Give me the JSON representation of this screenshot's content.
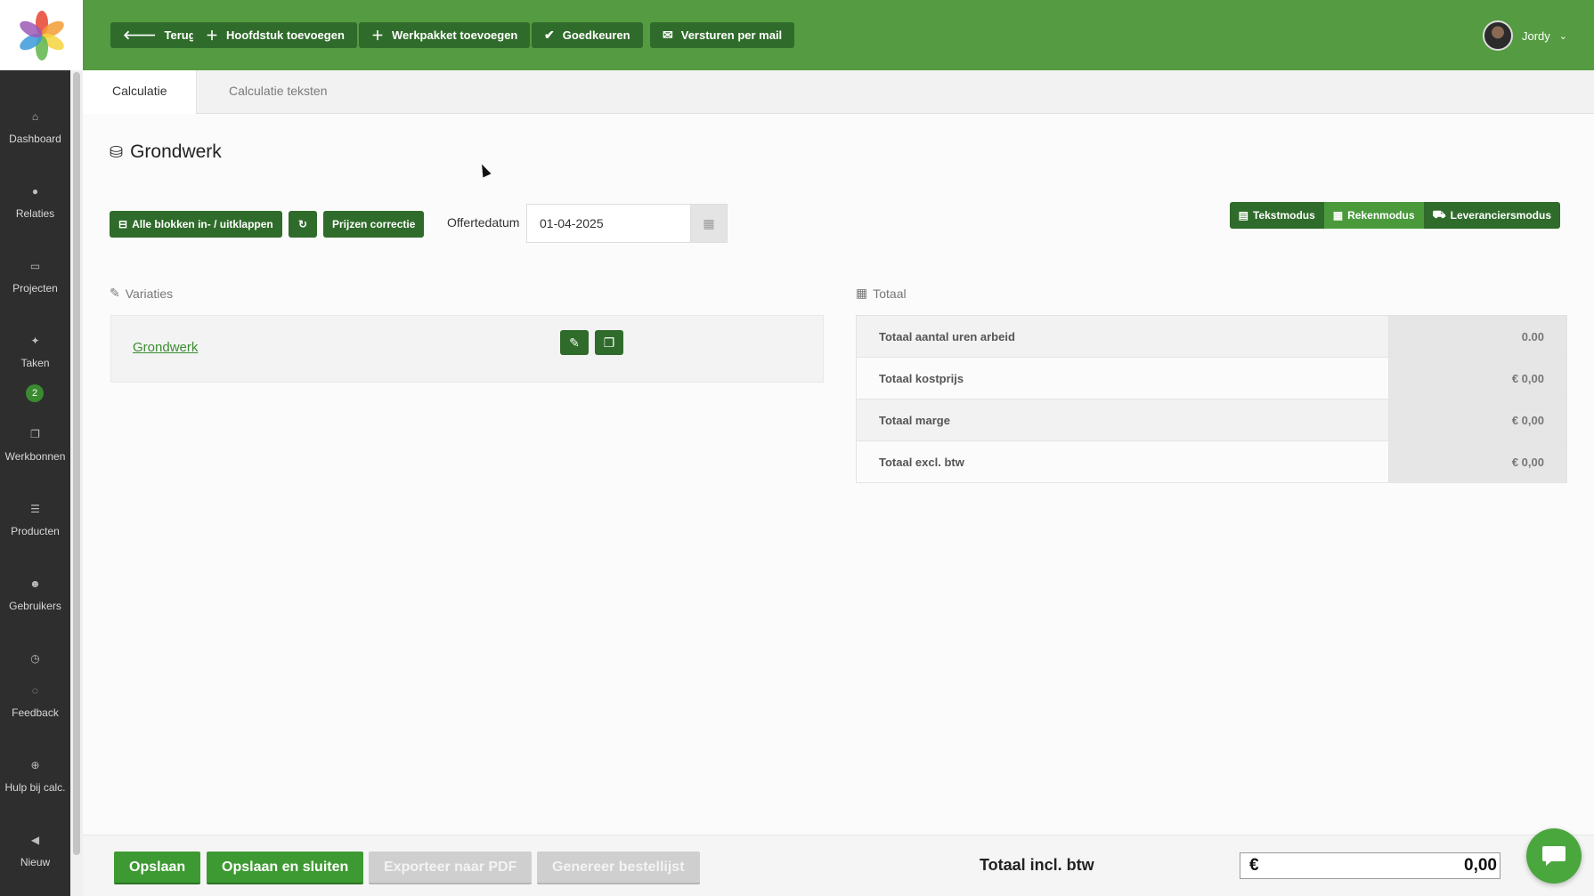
{
  "topbar": {
    "buttons": [
      {
        "label": "Terug",
        "icon": "arrow-left-icon"
      },
      {
        "label": "Hoofdstuk toevoegen",
        "icon": "plus-icon"
      },
      {
        "label": "Werkpakket toevoegen",
        "icon": "plus-icon"
      },
      {
        "label": "Goedkeuren",
        "icon": "check-icon"
      },
      {
        "label": "Versturen per mail",
        "icon": "envelope-icon"
      }
    ],
    "user_name": "Jordy"
  },
  "sidebar": {
    "items": [
      {
        "label": "Dashboard",
        "icon": "home-icon"
      },
      {
        "label": "Relaties",
        "icon": "user-icon"
      },
      {
        "label": "Projecten",
        "icon": "inbox-icon"
      },
      {
        "label": "Taken",
        "icon": "pin-icon",
        "badge": "2"
      },
      {
        "label": "Werkbonnen",
        "icon": "copy-icon"
      },
      {
        "label": "Producten",
        "icon": "list-icon"
      },
      {
        "label": "Gebruikers",
        "icon": "users-icon"
      },
      {
        "label": "Feedback",
        "icon": "comment-icon"
      },
      {
        "label": "Hulp bij calc.",
        "icon": "lifebuoy-icon"
      },
      {
        "label": "Nieuw",
        "icon": "bullhorn-icon"
      }
    ]
  },
  "tabs": [
    {
      "label": "Calculatie",
      "active": true
    },
    {
      "label": "Calculatie teksten",
      "active": false
    }
  ],
  "page": {
    "title": "Grondwerk",
    "toolbar": {
      "collapse_label": "Alle blokken in- / uitklappen",
      "price_correction_label": "Prijzen correctie",
      "date_label": "Offertedatum",
      "date_value": "01-04-2025"
    },
    "modes": [
      {
        "label": "Tekstmodus",
        "color": "#2f6b2a"
      },
      {
        "label": "Rekenmodus",
        "color": "#4a9a3c"
      },
      {
        "label": "Leveranciersmodus",
        "color": "#2f6b2a"
      }
    ],
    "variations": {
      "section_label": "Variaties",
      "items": [
        {
          "name": "Grondwerk"
        }
      ]
    },
    "totals": {
      "section_label": "Totaal",
      "rows": [
        {
          "label": "Totaal aantal uren arbeid",
          "value": "0.00"
        },
        {
          "label": "Totaal kostprijs",
          "value": "€ 0,00"
        },
        {
          "label": "Totaal marge",
          "value": "€ 0,00"
        },
        {
          "label": "Totaal excl. btw",
          "value": "€ 0,00"
        }
      ]
    }
  },
  "footer": {
    "save_label": "Opslaan",
    "save_close_label": "Opslaan en sluiten",
    "export_pdf_label": "Exporteer naar PDF",
    "order_list_label": "Genereer bestellijst",
    "total_label": "Totaal incl. btw",
    "currency_symbol": "€",
    "total_value": "0,00"
  },
  "colors": {
    "brand_green": "#549b41",
    "button_dark_green": "#2f6b2a",
    "sidebar_bg": "#2e2e2e"
  }
}
